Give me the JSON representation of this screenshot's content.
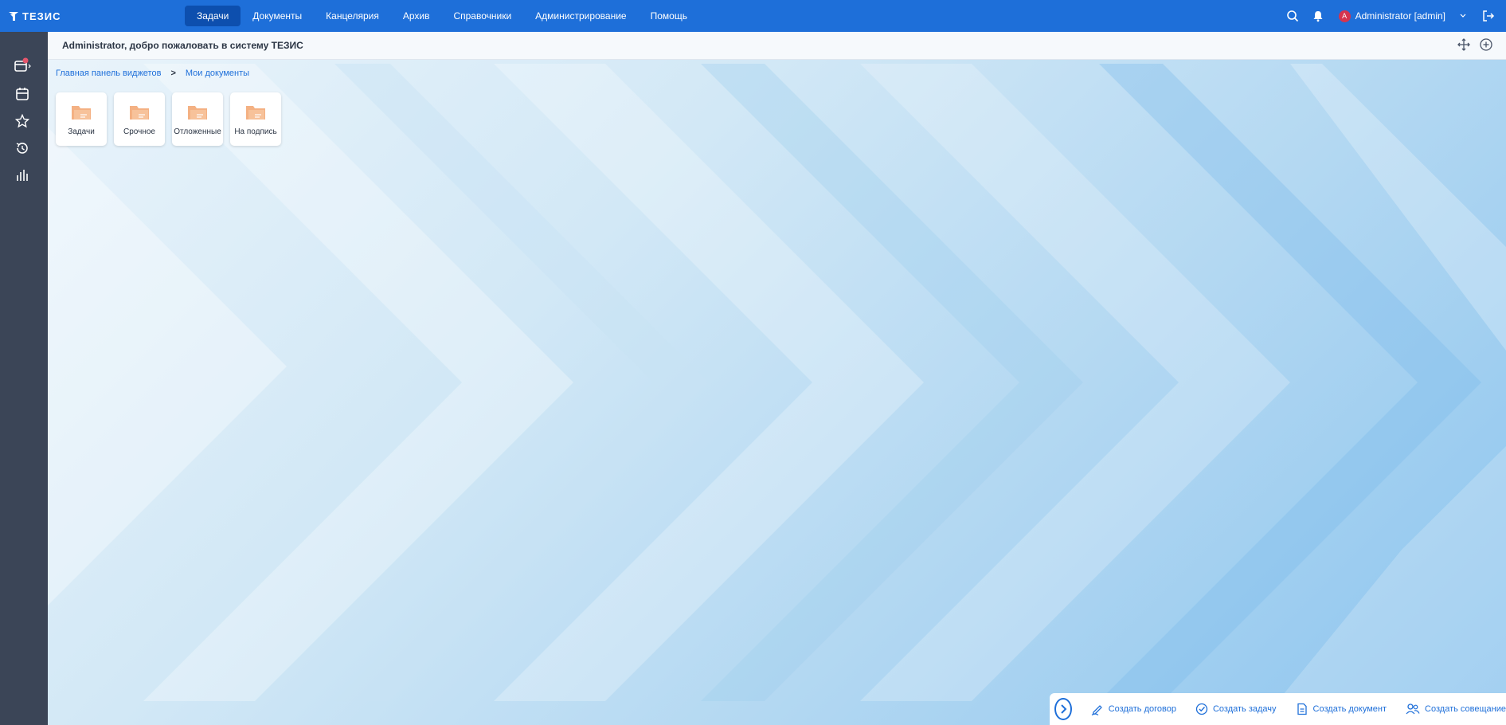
{
  "app": {
    "logo_text": "ТЕЗИС"
  },
  "menu": {
    "items": [
      {
        "label": "Задачи",
        "active": true
      },
      {
        "label": "Документы"
      },
      {
        "label": "Канцелярия"
      },
      {
        "label": "Архив"
      },
      {
        "label": "Справочники"
      },
      {
        "label": "Администрирование"
      },
      {
        "label": "Помощь"
      }
    ]
  },
  "user": {
    "avatar_letter": "A",
    "name": "Administrator [admin]"
  },
  "header": {
    "welcome": "Administrator, добро пожаловать в систему ТЕЗИС"
  },
  "breadcrumb": {
    "root": "Главная панель виджетов",
    "separator": ">",
    "current": "Мои документы"
  },
  "folders": [
    {
      "label": "Задачи"
    },
    {
      "label": "Срочное"
    },
    {
      "label": "Отложенные"
    },
    {
      "label": "На подпись"
    }
  ],
  "actions": {
    "create_contract": "Создать договор",
    "create_task": "Создать задачу",
    "create_document": "Создать документ",
    "create_meeting": "Создать совещание"
  },
  "colors": {
    "topbar": "#1e6fd9",
    "sidebar": "#3b4557",
    "accent": "#1e6fd9",
    "folder": "#f4b183",
    "avatar": "#d6344e"
  }
}
